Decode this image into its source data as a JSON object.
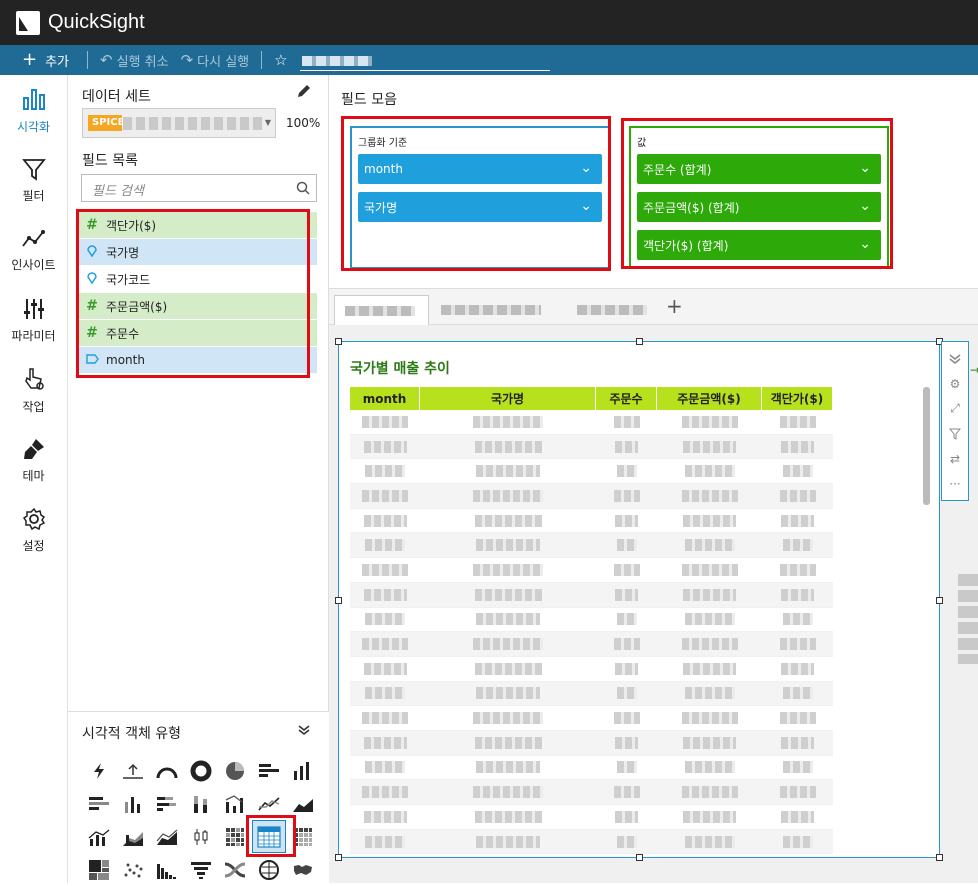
{
  "app": {
    "title": "QuickSight"
  },
  "toolbar": {
    "add": "추가",
    "undo": "실행 취소",
    "redo": "다시 실행"
  },
  "nav": [
    {
      "label": "시각화",
      "icon": "visualize-icon"
    },
    {
      "label": "필터",
      "icon": "filter-icon"
    },
    {
      "label": "인사이트",
      "icon": "insights-icon"
    },
    {
      "label": "파라미터",
      "icon": "parameters-icon"
    },
    {
      "label": "작업",
      "icon": "actions-icon"
    },
    {
      "label": "테마",
      "icon": "themes-icon"
    },
    {
      "label": "설정",
      "icon": "settings-icon"
    }
  ],
  "dataset": {
    "title": "데이터 세트",
    "badge": "SPICE",
    "percent": "100%"
  },
  "fieldlist": {
    "title": "필드 목록",
    "search_placeholder": "필드 검색",
    "items": [
      {
        "label": "객단가($)",
        "type": "measure"
      },
      {
        "label": "국가명",
        "type": "dimension"
      },
      {
        "label": "국가코드",
        "type": "dimension"
      },
      {
        "label": "주문금액($)",
        "type": "measure"
      },
      {
        "label": "주문수",
        "type": "measure"
      },
      {
        "label": "month",
        "type": "date"
      }
    ]
  },
  "visual_types": {
    "title": "시각적 객체 유형"
  },
  "wells": {
    "title": "필드 모음",
    "group_by": {
      "label": "그룹화 기준",
      "items": [
        "month",
        "국가명"
      ]
    },
    "value": {
      "label": "값",
      "items": [
        "주문수 (합계)",
        "주문금액($) (합계)",
        "객단가($) (합계)"
      ]
    }
  },
  "visual": {
    "title": "국가별 매출 추이",
    "columns": [
      "month",
      "국가명",
      "주문수",
      "주문금액($)",
      "객단가($)"
    ]
  },
  "colors": {
    "accent": "#1a85c8",
    "measure": "#2da90a",
    "dimension": "#1fa0dc",
    "header": "#b8e11d",
    "highlight": "#e00b14"
  }
}
